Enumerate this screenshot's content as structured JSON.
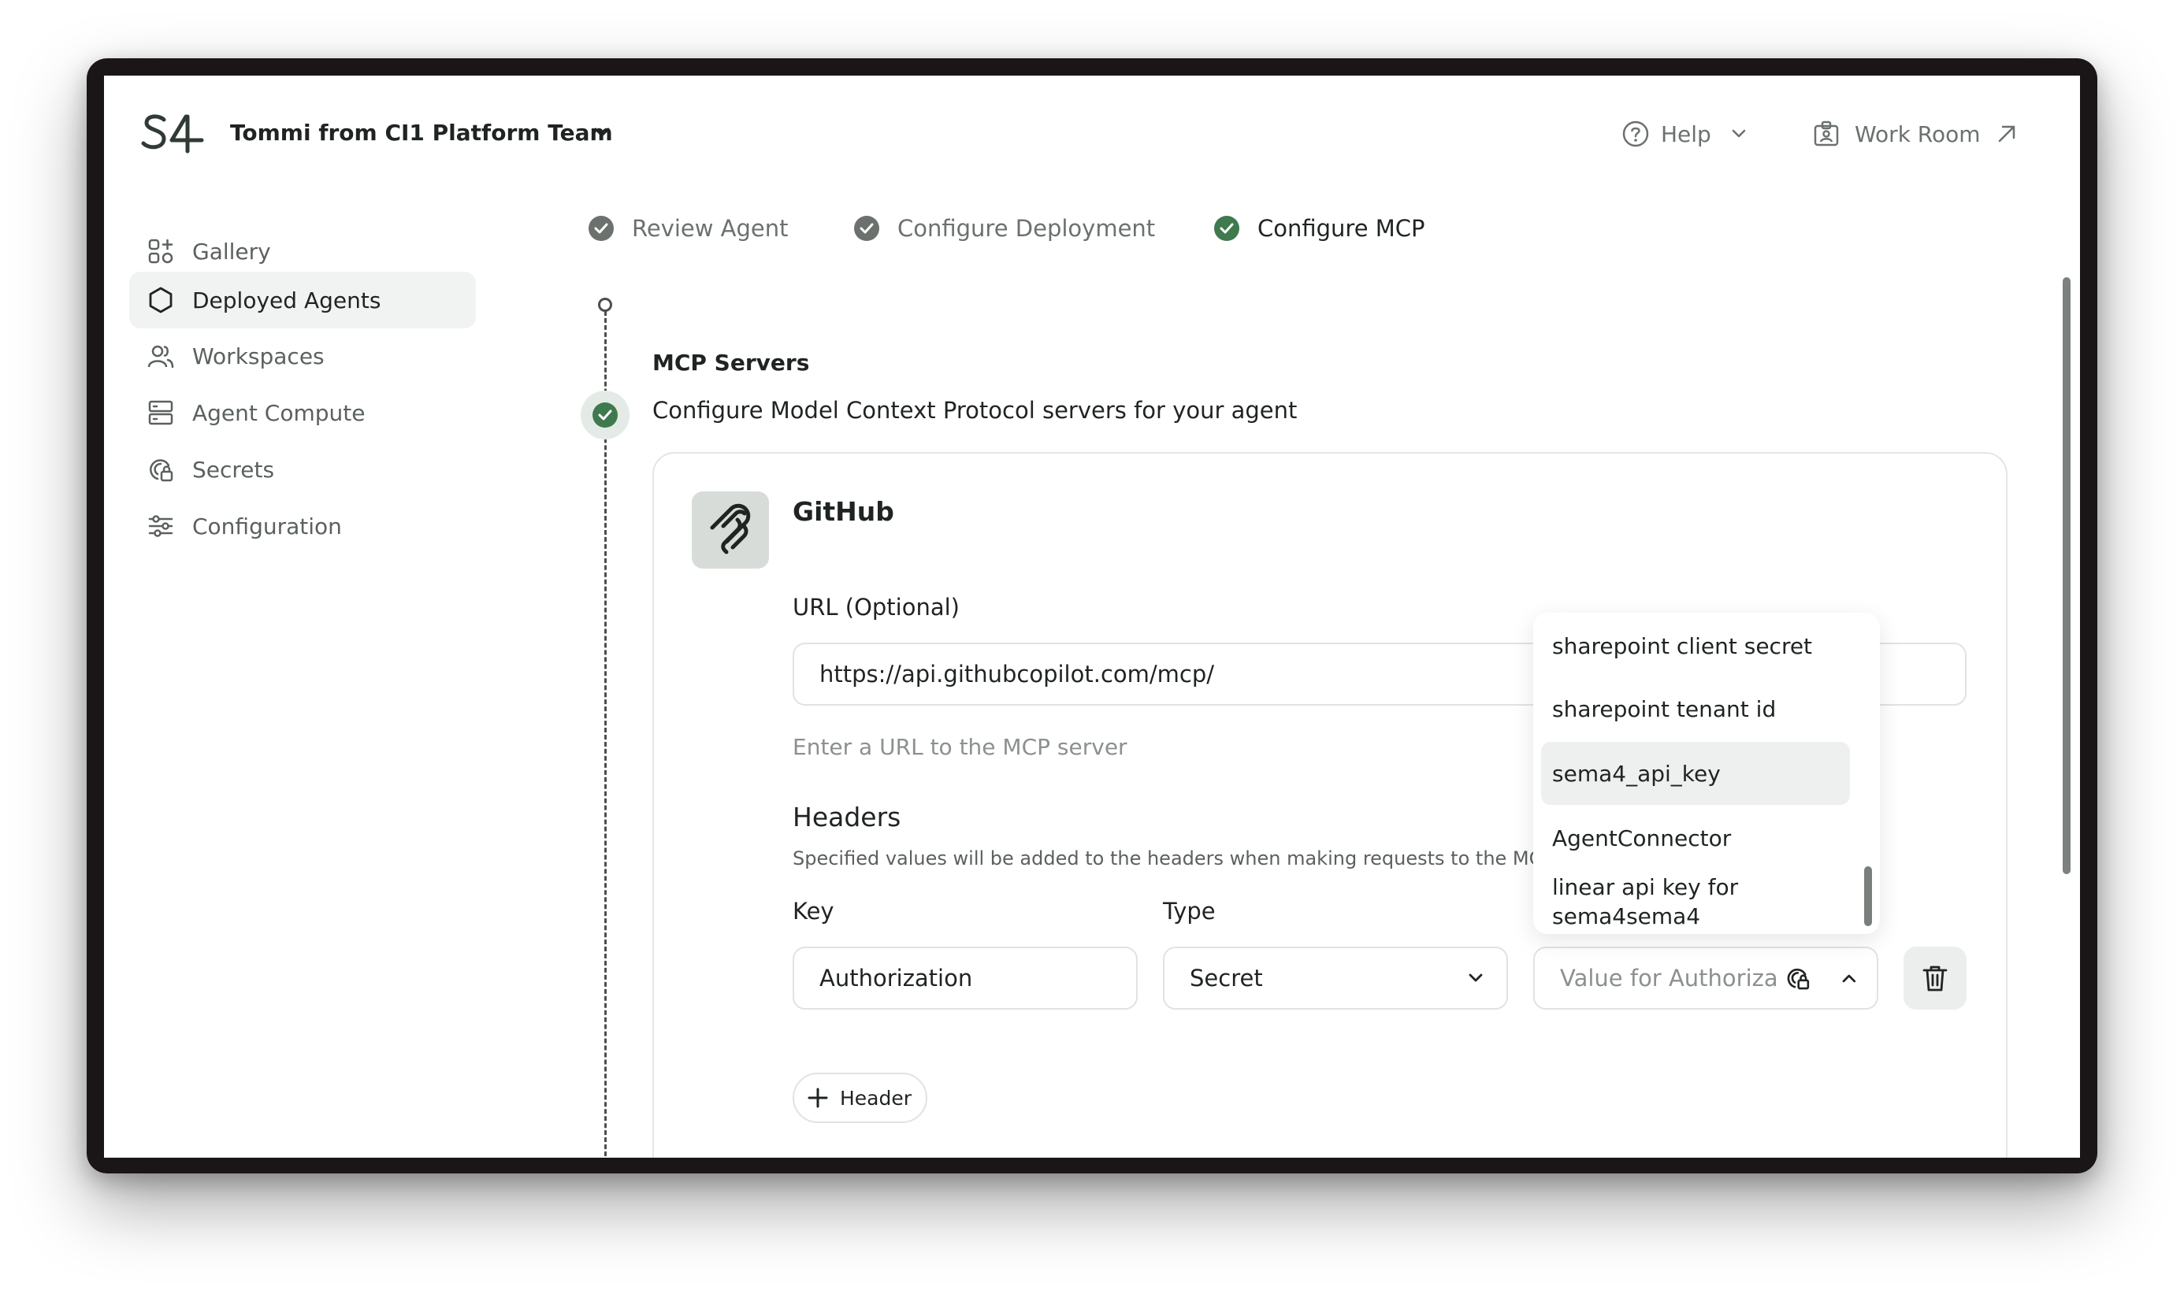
{
  "header": {
    "team_name": "Tommi from CI1 Platform Team",
    "help_label": "Help",
    "workroom_label": "Work Room"
  },
  "sidebar": {
    "items": [
      {
        "label": "Gallery",
        "icon": "gallery-icon"
      },
      {
        "label": "Deployed Agents",
        "icon": "hexagon-icon",
        "active": true
      },
      {
        "label": "Workspaces",
        "icon": "users-icon"
      },
      {
        "label": "Agent Compute",
        "icon": "server-icon"
      },
      {
        "label": "Secrets",
        "icon": "secret-lock-icon"
      },
      {
        "label": "Configuration",
        "icon": "sliders-icon"
      }
    ]
  },
  "steps": [
    {
      "label": "Review Agent",
      "status": "done"
    },
    {
      "label": "Configure Deployment",
      "status": "done"
    },
    {
      "label": "Configure MCP",
      "status": "current"
    }
  ],
  "section": {
    "title": "MCP Servers",
    "subtitle": "Configure Model Context Protocol servers for your agent"
  },
  "card": {
    "title": "GitHub",
    "url_label": "URL (Optional)",
    "url_value": "https://api.githubcopilot.com/mcp/",
    "url_hint": "Enter a URL to the MCP server",
    "headers_title": "Headers",
    "headers_desc": "Specified values will be added to the headers when making requests to the MCP Server",
    "key_label": "Key",
    "type_label": "Type",
    "key_value": "Authorization",
    "type_value": "Secret",
    "value_placeholder": "Value for Authorization",
    "add_header_label": "Header"
  },
  "dropdown": {
    "options": [
      "sharepoint client secret",
      "sharepoint tenant id",
      "sema4_api_key",
      "AgentConnector",
      "linear api key for sema4sema4"
    ],
    "highlighted": "sema4_api_key"
  },
  "colors": {
    "accent_green": "#3f7a4f",
    "done_gray": "#6b716d",
    "frame": "#1a1618"
  }
}
